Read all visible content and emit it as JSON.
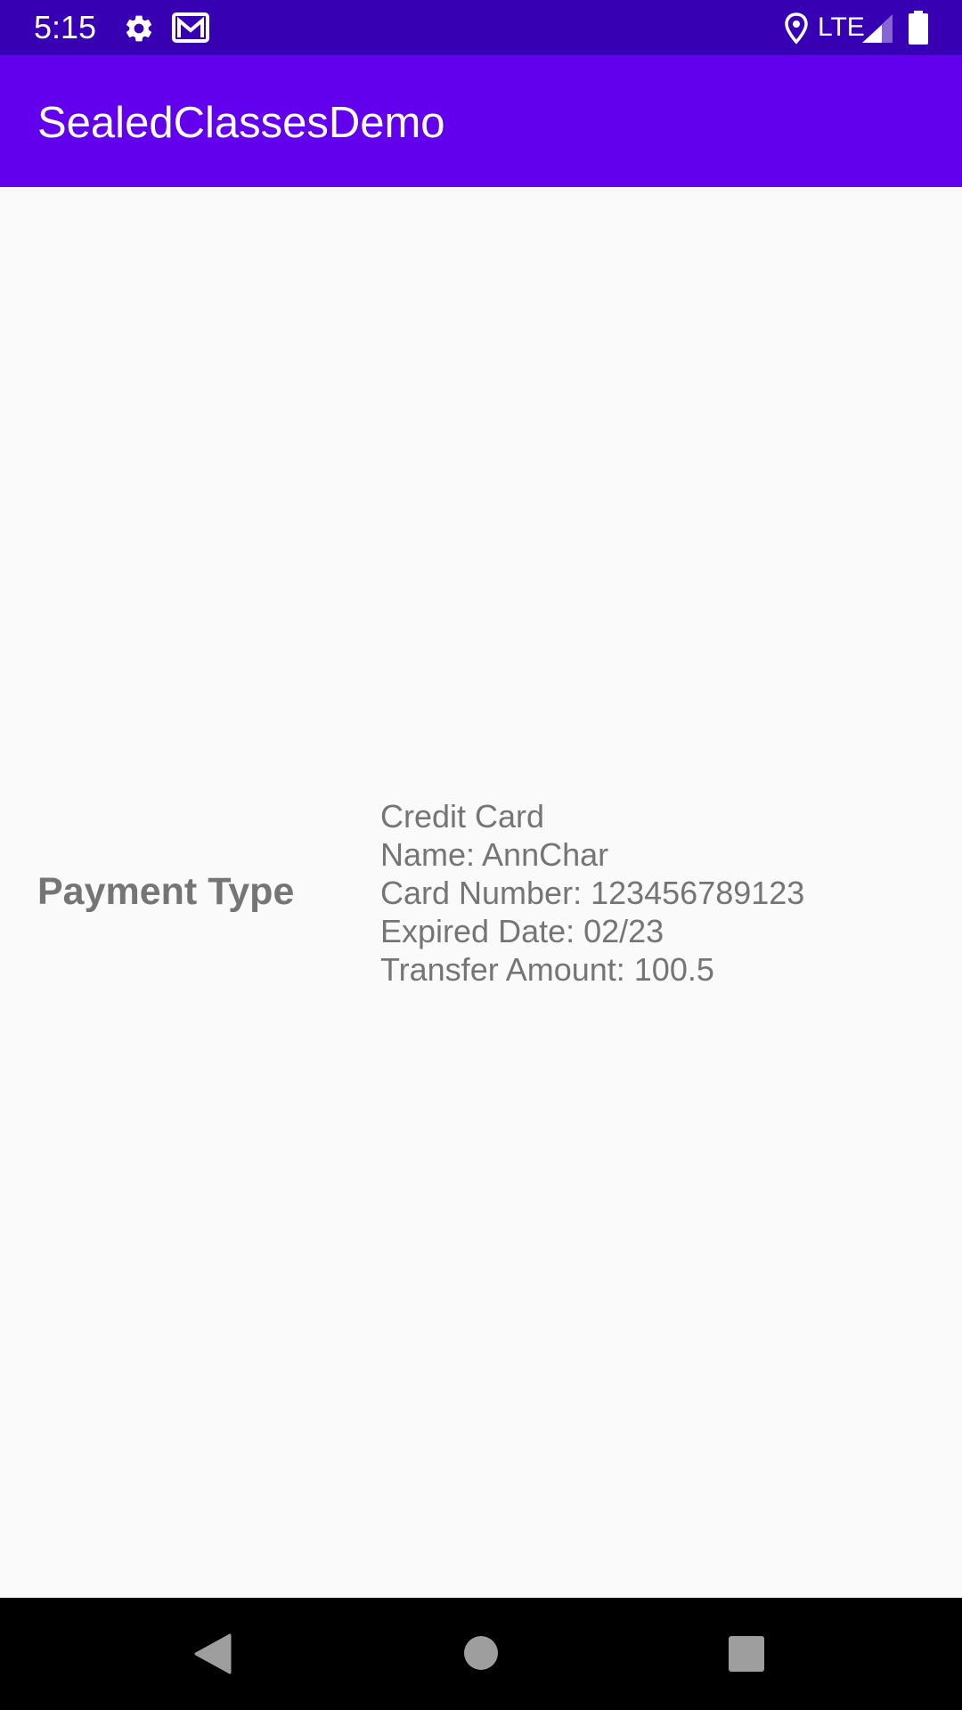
{
  "status_bar": {
    "time": "5:15",
    "network": "LTE",
    "icons": [
      "settings-icon",
      "gmail-icon",
      "location-icon",
      "signal-icon",
      "battery-icon"
    ],
    "background_color": "#3700b3"
  },
  "app_bar": {
    "title": "SealedClassesDemo",
    "background_color": "#6200ee"
  },
  "main": {
    "payment_type_label": "Payment Type",
    "details": {
      "type": "Credit Card",
      "name": "Name: AnnChar",
      "card_number": "Card Number: 123456789123",
      "expired_date": "Expired Date: 02/23",
      "transfer_amount": "Transfer Amount: 100.5"
    },
    "text_color": "#757575"
  },
  "nav_bar": {
    "buttons": [
      "back-icon",
      "home-icon",
      "recents-icon"
    ]
  }
}
